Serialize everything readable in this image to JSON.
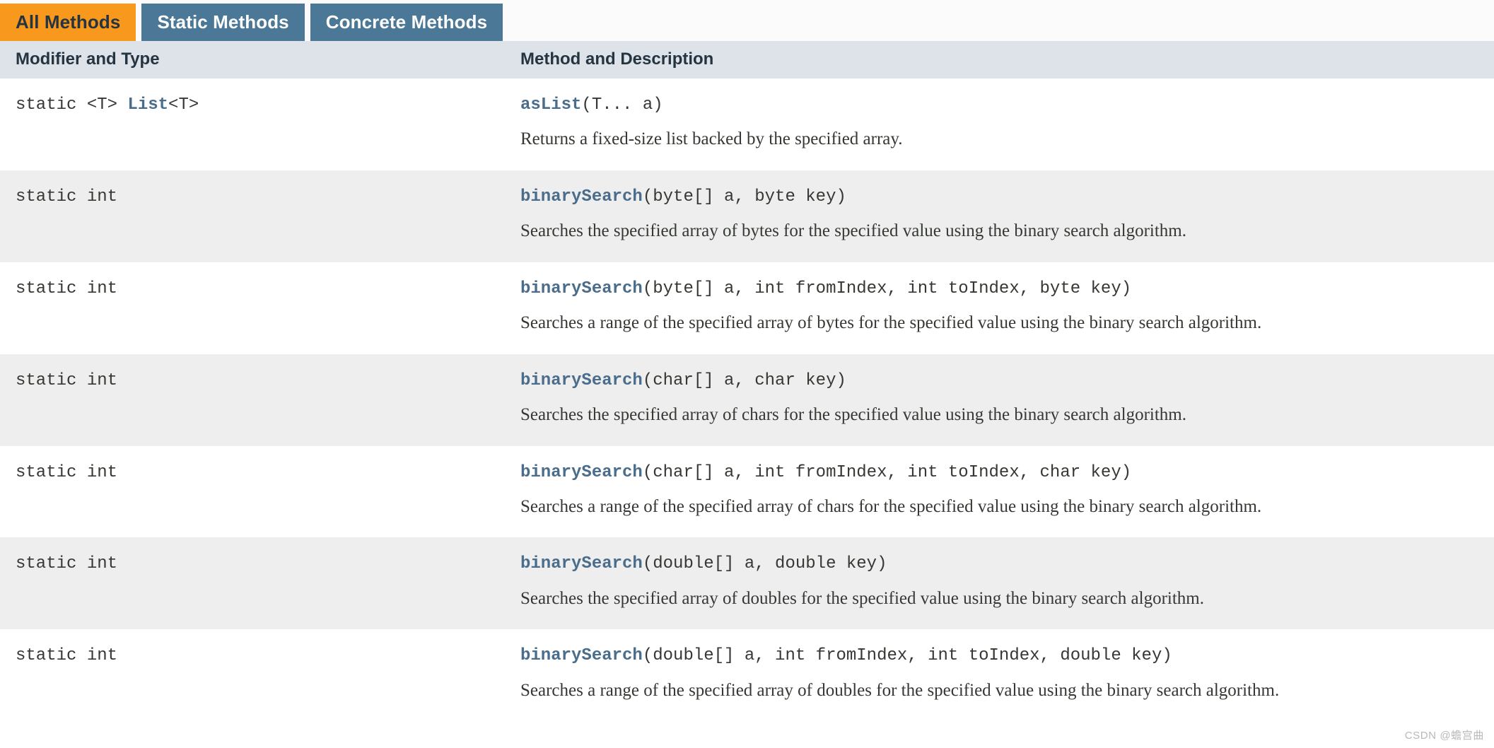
{
  "tabs": [
    {
      "label": "All Methods",
      "active": true
    },
    {
      "label": "Static Methods",
      "active": false
    },
    {
      "label": "Concrete Methods",
      "active": false
    }
  ],
  "table": {
    "headers": {
      "modifier_and_type": "Modifier and Type",
      "method_and_description": "Method and Description"
    },
    "rows": [
      {
        "modifier_prefix": "static <T> ",
        "modifier_link": "List",
        "modifier_suffix": "<T>",
        "method_name": "asList",
        "method_params": "(T... a)",
        "description": "Returns a fixed-size list backed by the specified array.",
        "stripe": "white",
        "narrow": false
      },
      {
        "modifier_prefix": "static int",
        "modifier_link": "",
        "modifier_suffix": "",
        "method_name": "binarySearch",
        "method_params": "(byte[] a, byte key)",
        "description": "Searches the specified array of bytes for the specified value using the binary search algorithm.",
        "stripe": "alt",
        "narrow": false
      },
      {
        "modifier_prefix": "static int",
        "modifier_link": "",
        "modifier_suffix": "",
        "method_name": "binarySearch",
        "method_params": "(byte[] a, int fromIndex, int toIndex, byte key)",
        "description": "Searches a range of the specified array of bytes for the specified value using the binary search algorithm.",
        "stripe": "white",
        "narrow": false
      },
      {
        "modifier_prefix": "static int",
        "modifier_link": "",
        "modifier_suffix": "",
        "method_name": "binarySearch",
        "method_params": "(char[] a, char key)",
        "description": "Searches the specified array of chars for the specified value using the binary search algorithm.",
        "stripe": "alt",
        "narrow": false
      },
      {
        "modifier_prefix": "static int",
        "modifier_link": "",
        "modifier_suffix": "",
        "method_name": "binarySearch",
        "method_params": "(char[] a, int fromIndex, int toIndex, char key)",
        "description": "Searches a range of the specified array of chars for the specified value using the binary search algorithm.",
        "stripe": "white",
        "narrow": false
      },
      {
        "modifier_prefix": "static int",
        "modifier_link": "",
        "modifier_suffix": "",
        "method_name": "binarySearch",
        "method_params": "(double[] a, double key)",
        "description": "Searches the specified array of doubles for the specified value using the binary search algorithm.",
        "stripe": "alt",
        "narrow": true
      },
      {
        "modifier_prefix": "static int",
        "modifier_link": "",
        "modifier_suffix": "",
        "method_name": "binarySearch",
        "method_params": "(double[] a, int fromIndex, int toIndex, double key)",
        "description": "Searches a range of the specified array of doubles for the specified value using the binary search algorithm.",
        "stripe": "white",
        "narrow": false
      }
    ]
  },
  "watermark": "CSDN @蟾宫曲",
  "colors": {
    "tab_active_bg": "#f8981d",
    "tab_inactive_bg": "#4a7896",
    "header_bg": "#dee3e9",
    "row_alt_bg": "#eeeeef",
    "link": "#4a6d8c",
    "text": "#353833"
  }
}
